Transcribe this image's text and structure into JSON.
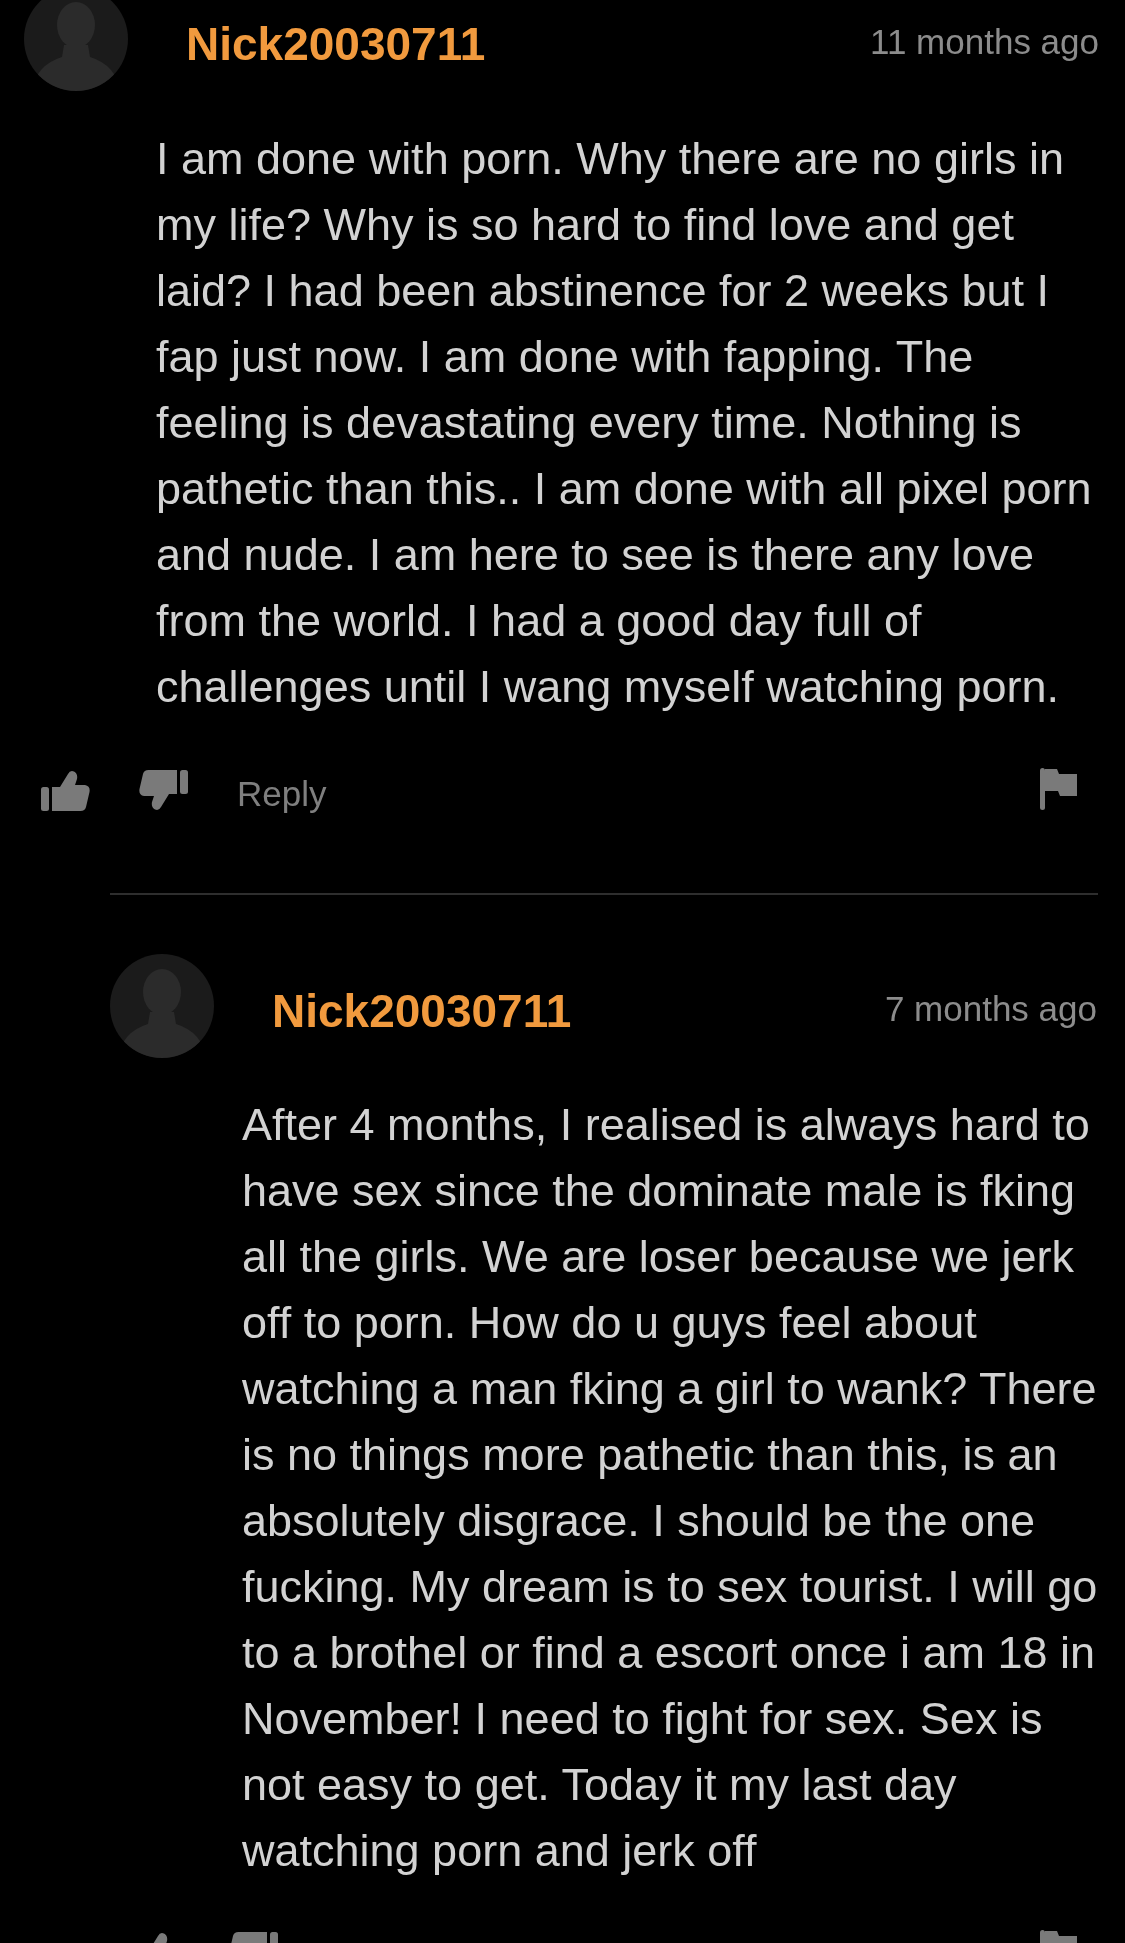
{
  "comments": [
    {
      "username": "Nick20030711",
      "time": "11 months ago",
      "text": "I am done with porn. Why there are no girls in my life? Why is so hard to find love and get laid? I had been abstinence for 2 weeks but I fap just now. I am done with fapping. The feeling is devastating every time. Nothing is pathetic than this.. I am done with all pixel porn and nude. I am here to see is there any love from the world. I had a good day full of challenges until I wang myself watching porn.",
      "reply_label": "Reply",
      "replies": [
        {
          "username": "Nick20030711",
          "time": "7 months ago",
          "text": "After 4 months, I realised is always hard to have sex since the dominate male is fking all the girls. We are loser because we jerk off to porn. How do u guys feel about watching a man fking a girl to wank? There is no things more pathetic than this, is an absolutely disgrace. I should be the one fucking. My dream is to sex tourist. I will go to a brothel or find a escort once i am 18 in November! I need to fight for sex. Sex is not easy to get. Today it my last day watching porn and jerk off"
        }
      ]
    }
  ]
}
